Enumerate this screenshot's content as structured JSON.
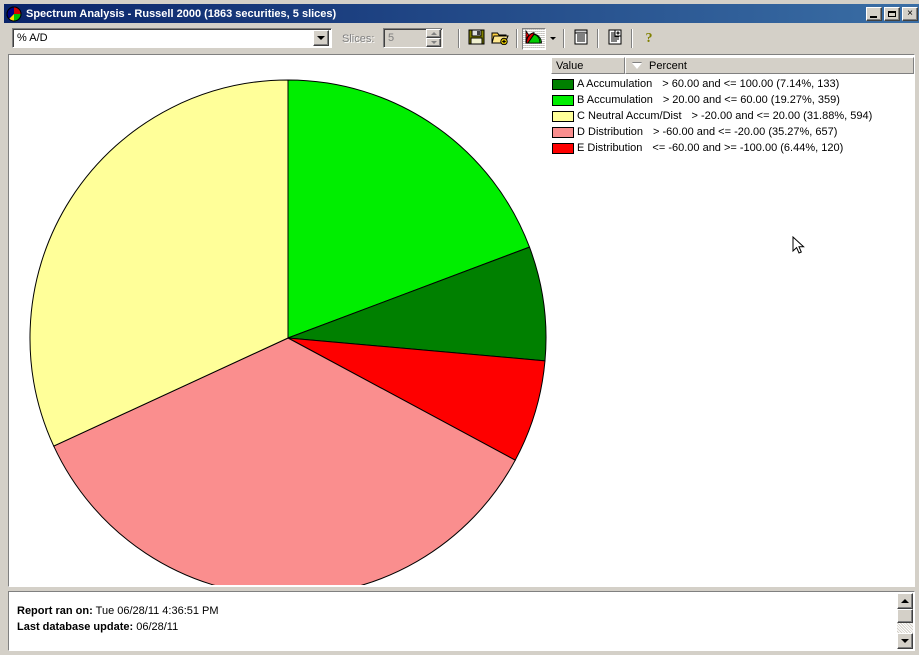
{
  "window": {
    "title": "Spectrum Analysis - Russell 2000 (1863 securities, 5 slices)",
    "icon": "pie-chart-icon",
    "minimize_label": "_",
    "maximize_label": "□",
    "close_label": "×"
  },
  "toolbar": {
    "metric_select": {
      "value": "% A/D",
      "icon": "chevron-down-icon"
    },
    "slices_label": "Slices:",
    "slices_value": "5",
    "buttons": [
      {
        "name": "save-button",
        "icon": "floppy-disk-icon",
        "label": "Save"
      },
      {
        "name": "open-button",
        "icon": "open-folder-add-icon",
        "label": "Open"
      },
      {
        "name": "pie-chart-view-button",
        "icon": "pie-chart-icon",
        "label": "Pie Chart View"
      },
      {
        "name": "chart-type-dropdown",
        "icon": "chevron-down-icon",
        "label": "Chart Type"
      },
      {
        "name": "report-view-button",
        "icon": "list-report-icon",
        "label": "Report View"
      },
      {
        "name": "new-report-button",
        "icon": "report-add-icon",
        "label": "New Report"
      },
      {
        "name": "help-button",
        "icon": "question-mark-icon",
        "label": "Help"
      }
    ]
  },
  "legend": {
    "columns": [
      {
        "label": "Value",
        "sorted": false
      },
      {
        "label": "Percent",
        "sorted": true,
        "sort_icon": "sort-descending-icon"
      }
    ],
    "rows": [
      {
        "color": "#008000",
        "label": "A Accumulation",
        "range": "> 60.00 and <= 100.00 (7.14%, 133)"
      },
      {
        "color": "#00ee00",
        "label": "B Accumulation",
        "range": "> 20.00 and <= 60.00 (19.27%, 359)"
      },
      {
        "color": "#ffff99",
        "label": "C Neutral Accum/Dist",
        "range": "> -20.00 and <= 20.00 (31.88%, 594)"
      },
      {
        "color": "#fa8e8e",
        "label": "D Distribution",
        "range": "> -60.00 and <= -20.00 (35.27%, 657)"
      },
      {
        "color": "#fe0000",
        "label": "E Distribution",
        "range": "<= -60.00 and >= -100.00 (6.44%, 120)"
      }
    ]
  },
  "chart_data": {
    "type": "pie",
    "title": "Spectrum Analysis - Russell 2000",
    "subtitle": "1863 securities, 5 slices",
    "metric": "% A/D",
    "start_angle": 0,
    "direction": "clockwise",
    "slice_order": [
      "B Accumulation",
      "A Accumulation",
      "E Distribution",
      "D Distribution",
      "C Neutral Accum/Dist"
    ],
    "categories": [
      "A Accumulation",
      "B Accumulation",
      "C Neutral Accum/Dist",
      "D Distribution",
      "E Distribution"
    ],
    "values": [
      7.14,
      19.27,
      31.88,
      35.27,
      6.44
    ],
    "counts": [
      133,
      359,
      594,
      657,
      120
    ],
    "colors": [
      "#008000",
      "#00ee00",
      "#ffff99",
      "#fa8e8e",
      "#fe0000"
    ],
    "ranges": [
      "> 60.00 and <= 100.00",
      "> 20.00 and <= 60.00",
      "> -20.00 and <= 20.00",
      "> -60.00 and <= -20.00",
      "<= -60.00 and >= -100.00"
    ],
    "total_count": 1863,
    "unit": "%",
    "legend_position": "right",
    "grid": false
  },
  "footer": {
    "report_ran_label": "Report ran on:",
    "report_ran_value": "Tue 06/28/11 4:36:51 PM",
    "last_update_label": "Last database update:",
    "last_update_value": "06/28/11"
  },
  "scrollbar": {
    "up_icon": "triangle-up-icon",
    "down_icon": "triangle-down-icon"
  }
}
